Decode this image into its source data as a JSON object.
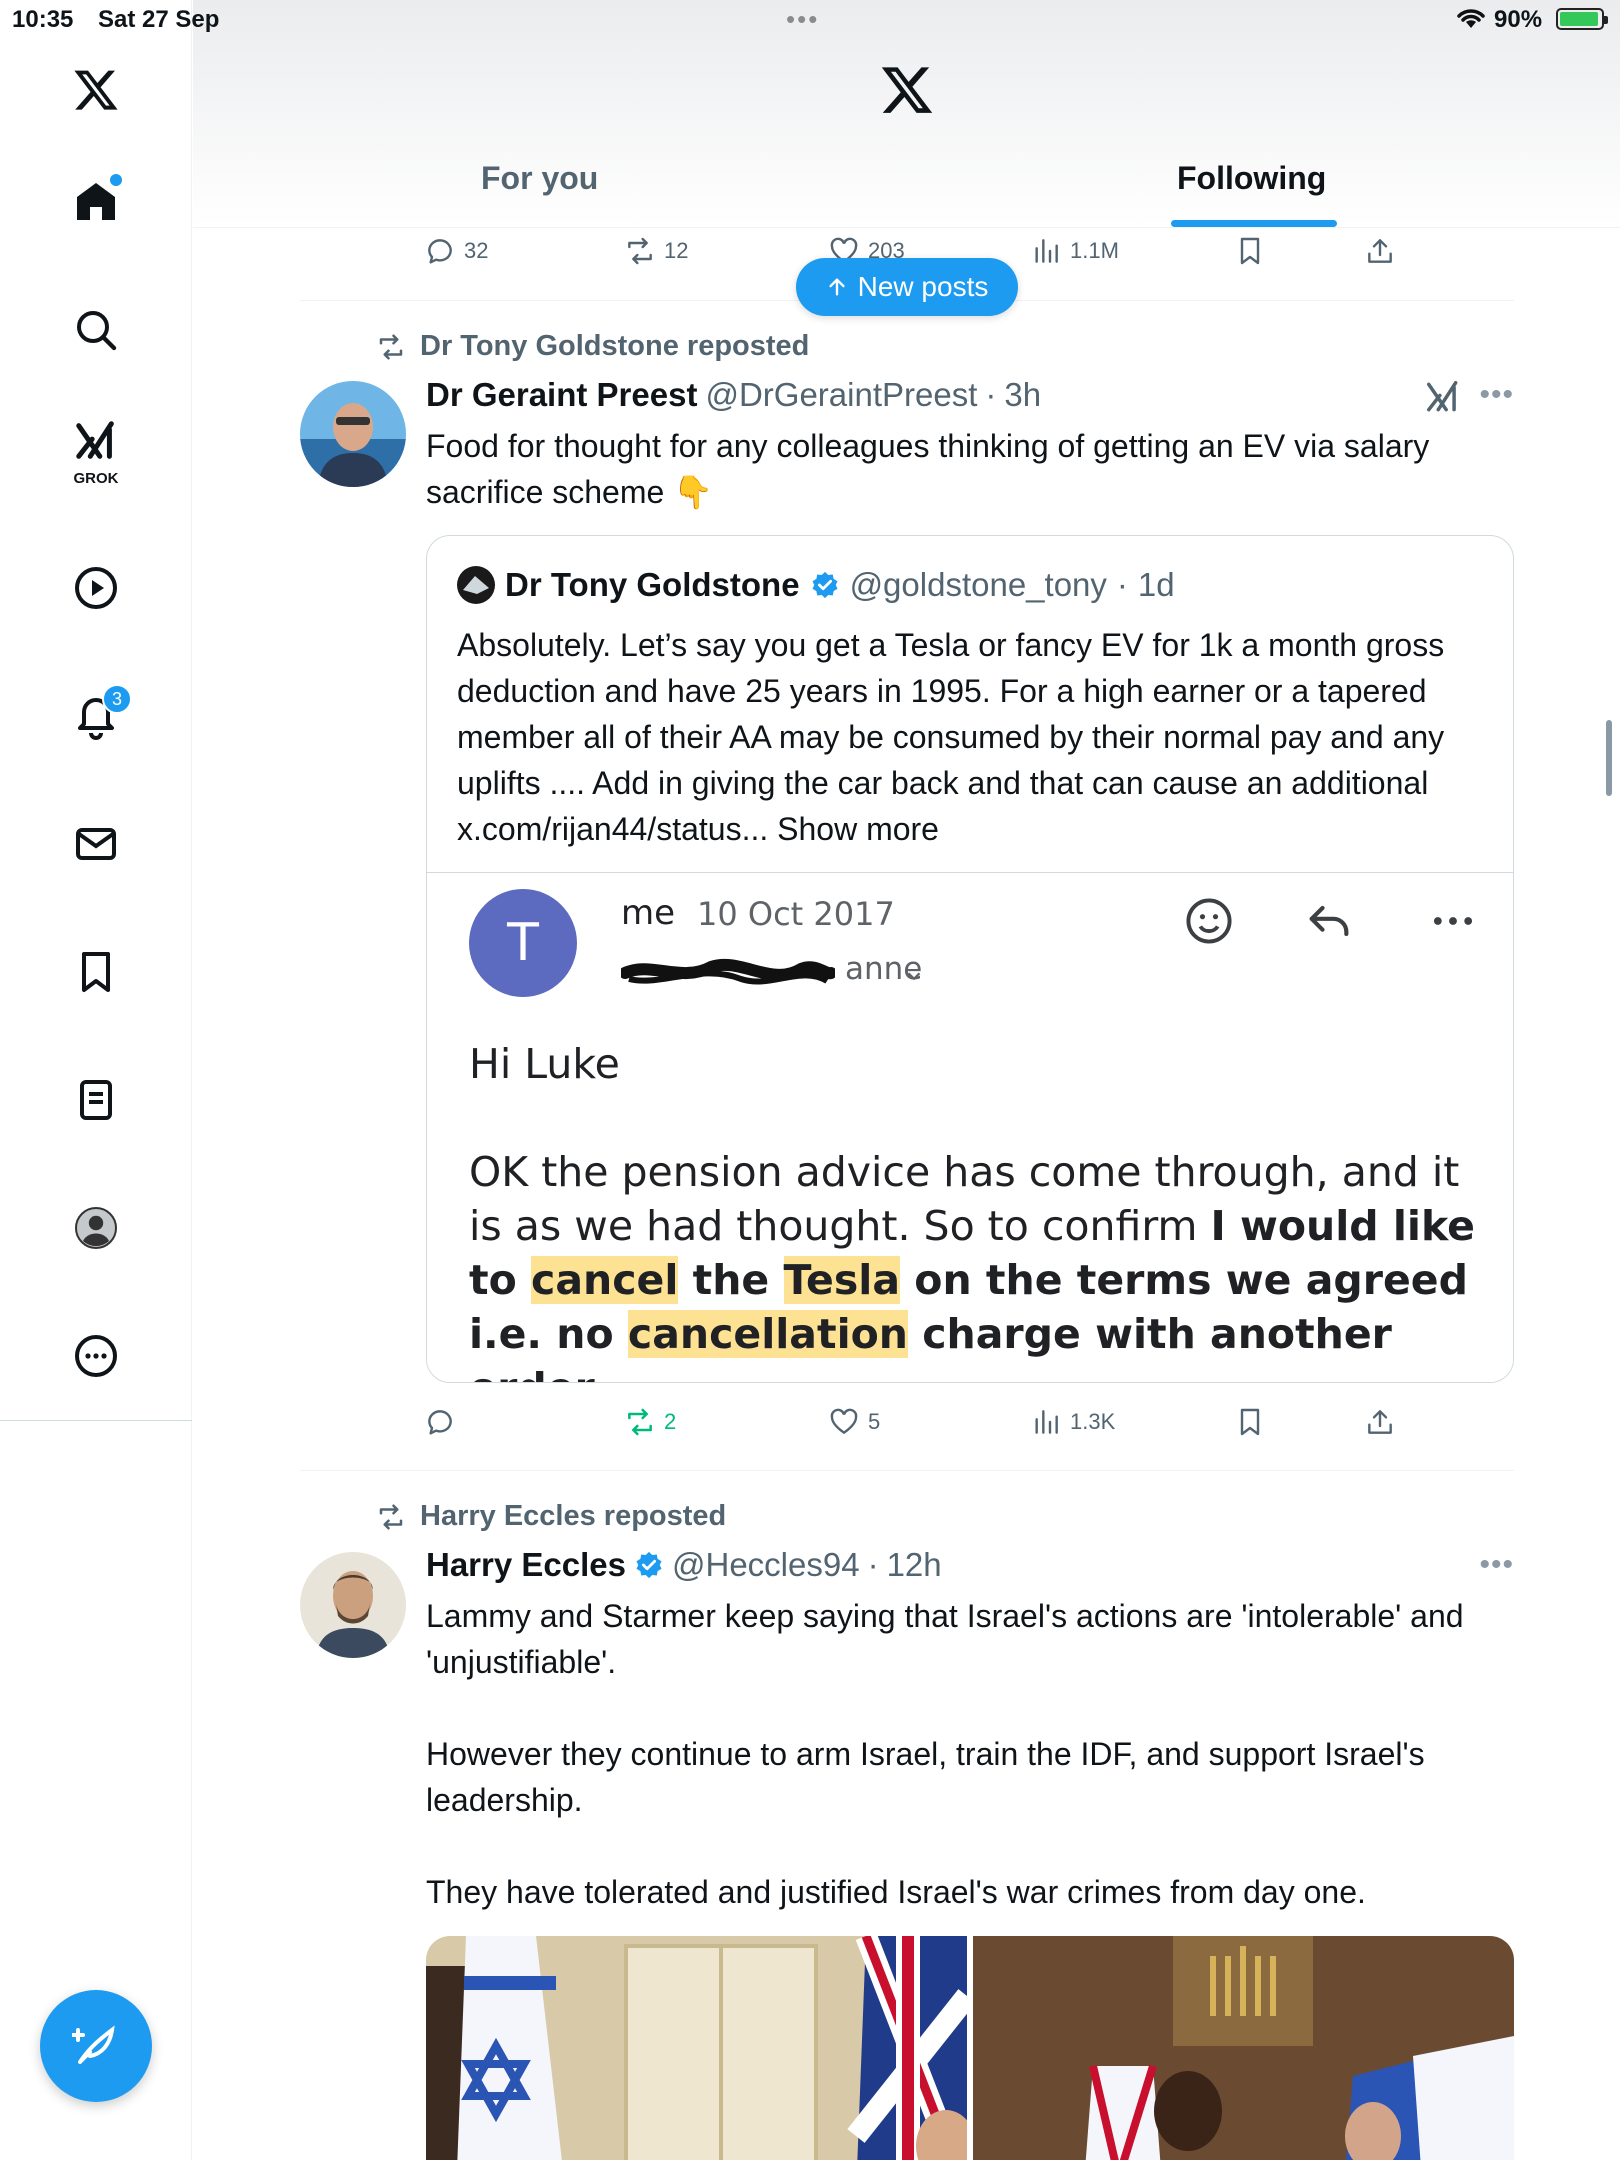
{
  "status_bar": {
    "time": "10:35",
    "date": "Sat 27 Sep",
    "battery": "90%"
  },
  "header": {
    "tabs": [
      {
        "label": "For you"
      },
      {
        "label": "Following"
      }
    ],
    "active_tab": "Following"
  },
  "sidebar": {
    "items": [
      {
        "name": "home"
      },
      {
        "name": "search"
      },
      {
        "name": "grok",
        "label": "GROK"
      },
      {
        "name": "video"
      },
      {
        "name": "notifications",
        "badge": "3"
      },
      {
        "name": "messages"
      },
      {
        "name": "bookmarks"
      },
      {
        "name": "lists"
      },
      {
        "name": "profile"
      },
      {
        "name": "more"
      }
    ]
  },
  "new_posts_pill": {
    "label": "New posts"
  },
  "prev_tweet_actions": {
    "replies": "32",
    "reposts": "12",
    "likes": "203",
    "views": "1.1M"
  },
  "tweets": [
    {
      "reposted_by": "Dr Tony Goldstone reposted",
      "name": "Dr Geraint Preest",
      "handle": "@DrGeraintPreest",
      "sep": "·",
      "time": "3h",
      "text": "Food for thought for any colleagues thinking of getting an EV via salary sacrifice scheme 👇",
      "quote": {
        "name": "Dr Tony Goldstone",
        "handle": "@goldstone_tony",
        "sep": "·",
        "time": "1d",
        "text": "Absolutely. Let’s say you get a Tesla or fancy EV for 1k a month gross deduction and have 25 years in 1995. For a high earner or a tapered member all of their AA may be consumed by their normal pay and any uplifts .... Add in giving the car back and that can cause an additional x.com/rijan44/status...",
        "show_more": "Show more",
        "email": {
          "avatar_letter": "T",
          "from": "me",
          "date": "10 Oct 2017",
          "to_visible": "anne",
          "greeting": "Hi Luke",
          "p1": "OK the pension advice has come through, and it is as we had thought. So to confirm ",
          "p1_bold_a": "I would like to ",
          "hl_cancel": "cancel",
          "p1_bold_b": " the ",
          "hl_tesla": "Tesla",
          "p1_bold_c": " on the terms we agreed i.e. no ",
          "hl_cancellation": "cancellation",
          "p1_bold_d": " charge with another order."
        }
      },
      "actions": {
        "replies": "",
        "reposts": "2",
        "likes": "5",
        "views": "1.3K"
      }
    },
    {
      "reposted_by": "Harry Eccles reposted",
      "name": "Harry Eccles",
      "handle": "@Heccles94",
      "sep": "·",
      "time": "12h",
      "text": "Lammy and Starmer keep saying that Israel's actions are 'intolerable' and 'unjustifiable'.\n\nHowever they continue to arm Israel, train the IDF, and support Israel's leadership.\n\nThey have tolerated and justified Israel's war crimes from day one."
    }
  ],
  "colors": {
    "accent": "#1d9bf0",
    "repost_green": "#00ba7c",
    "text_secondary": "#536471",
    "highlight": "#fde293"
  }
}
